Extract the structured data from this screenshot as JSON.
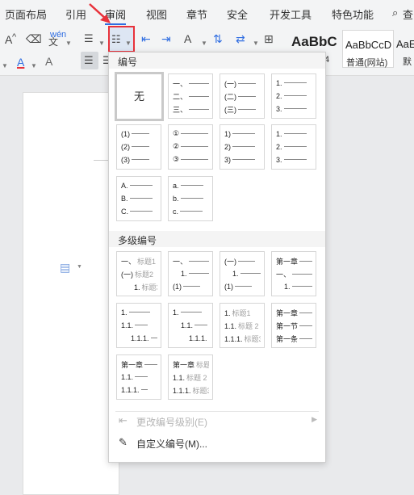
{
  "menu": {
    "items": [
      "页面布局",
      "引用",
      "审阅",
      "视图",
      "章节",
      "安全",
      "开发工具",
      "特色功能",
      "查"
    ]
  },
  "toolbar": {
    "font_grow": "A",
    "eraser": "⌫",
    "pinyin": "wén",
    "pinyin_char": "文",
    "font_color": "A",
    "char_shade": "A",
    "styles": [
      {
        "preview": "AaBbC",
        "caption": "4"
      },
      {
        "preview": "AaBbCcD",
        "caption": "普通(网站)"
      },
      {
        "preview": "AaE",
        "caption": "默"
      }
    ]
  },
  "dropdown": {
    "numbering_title": "编号",
    "none_label": "无",
    "numbering": [
      [
        "一、",
        "二、",
        "三、"
      ],
      [
        "(一)",
        "(二)",
        "(三)"
      ],
      [
        "1.",
        "2.",
        "3."
      ],
      [
        "(1)",
        "(2)",
        "(3)"
      ],
      [
        "①",
        "②",
        "③"
      ],
      [
        "1)",
        "2)",
        "3)"
      ],
      [
        "1.",
        "2.",
        "3."
      ],
      [
        "A.",
        "B.",
        "C."
      ],
      [
        "a.",
        "b.",
        "c."
      ]
    ],
    "multilevel_title": "多级编号",
    "multilevel": [
      [
        {
          "n": "一、",
          "t": "标题1"
        },
        {
          "n": "(一)",
          "t": "标题2"
        },
        {
          "n": "1.",
          "t": "标题3"
        }
      ],
      [
        {
          "n": "一、",
          "t": ""
        },
        {
          "n": "1.",
          "t": ""
        },
        {
          "n": "(1)",
          "t": ""
        }
      ],
      [
        {
          "n": "(一)",
          "t": ""
        },
        {
          "n": "1.",
          "t": ""
        },
        {
          "n": "(1)",
          "t": ""
        }
      ],
      [
        {
          "n": "第一章",
          "t": ""
        },
        {
          "n": "一、",
          "t": ""
        },
        {
          "n": "1.",
          "t": ""
        }
      ],
      [
        {
          "n": "1.",
          "t": ""
        },
        {
          "n": "1.1.",
          "t": ""
        },
        {
          "n": "1.1.1.",
          "t": ""
        }
      ],
      [
        {
          "n": "1.",
          "t": ""
        },
        {
          "n": "1.1.",
          "t": ""
        },
        {
          "n": "1.1.1.",
          "t": ""
        }
      ],
      [
        {
          "n": "1.",
          "t": "标题1"
        },
        {
          "n": "1.1.",
          "t": "标题 2"
        },
        {
          "n": "1.1.1.",
          "t": "标题3"
        }
      ],
      [
        {
          "n": "第一章",
          "t": ""
        },
        {
          "n": "第一节",
          "t": ""
        },
        {
          "n": "第一条",
          "t": ""
        }
      ],
      [
        {
          "n": "第一章",
          "t": ""
        },
        {
          "n": "1.1.",
          "t": ""
        },
        {
          "n": "1.1.1.",
          "t": ""
        }
      ],
      [
        {
          "n": "第一章",
          "t": "标题1"
        },
        {
          "n": "1.1.",
          "t": "标题 2"
        },
        {
          "n": "1.1.1.",
          "t": "标题3"
        }
      ]
    ],
    "change_level": "更改编号级别(E)",
    "custom": "自定义编号(M)..."
  },
  "colors": {
    "highlight_border": "#e8323b",
    "font_color_bar": "#e8323b",
    "accent": "#2f6de1"
  }
}
